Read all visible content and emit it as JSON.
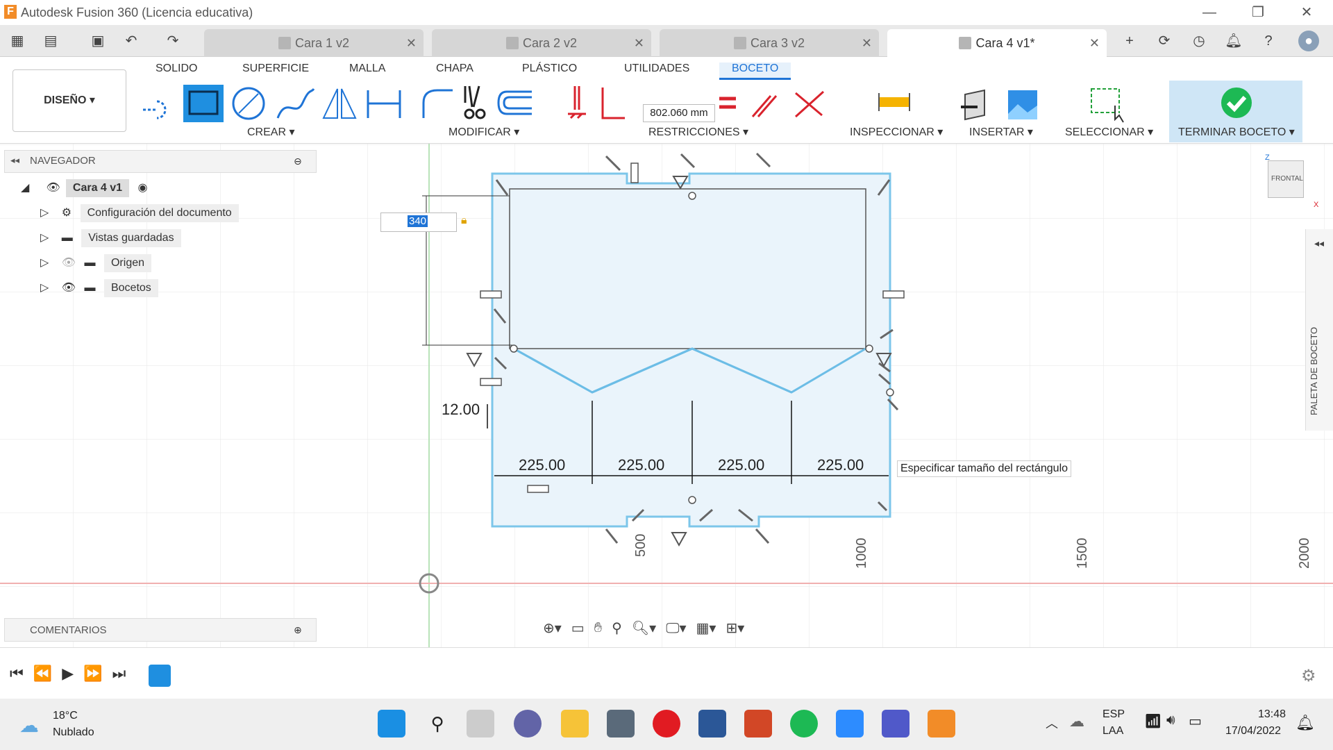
{
  "window": {
    "title": "Autodesk Fusion 360 (Licencia educativa)",
    "logo": "F"
  },
  "tabs": [
    {
      "label": "Cara 1 v2",
      "active": false
    },
    {
      "label": "Cara 2 v2",
      "active": false
    },
    {
      "label": "Cara 3 v2",
      "active": false
    },
    {
      "label": "Cara 4 v1*",
      "active": true
    }
  ],
  "ribbon": {
    "tabs": [
      "SOLIDO",
      "SUPERFICIE",
      "MALLA",
      "CHAPA",
      "PLÁSTICO",
      "UTILIDADES",
      "BOCETO"
    ],
    "active_tab": "BOCETO",
    "workspace": "DISEÑO ▾",
    "groups": {
      "crear": "CREAR ▾",
      "modificar": "MODIFICAR ▾",
      "restricciones": "RESTRICCIONES ▾",
      "inspeccionar": "INSPECCIONAR ▾",
      "insertar": "INSERTAR ▾",
      "seleccionar": "SELECCIONAR ▾",
      "terminar": "TERMINAR BOCETO ▾"
    },
    "length_readout": "802.060 mm"
  },
  "navigator": {
    "title": "NAVEGADOR",
    "root": "Cara 4 v1",
    "items": [
      "Configuración del documento",
      "Vistas guardadas",
      "Origen",
      "Bocetos"
    ]
  },
  "comments": {
    "title": "COMENTARIOS"
  },
  "canvas": {
    "dimension_input": "340",
    "dimension_left": "12.00",
    "widths": [
      "225.00",
      "225.00",
      "225.00",
      "225.00"
    ],
    "tooltip": "Especificar tamaño del rectángulo",
    "axis_ticks": [
      "500",
      "1000",
      "1500",
      "2000"
    ],
    "viewcube": "FRONTAL",
    "axis_z": "Z",
    "axis_x": "X",
    "sketch_palette": "PALETA DE BOCETO"
  },
  "colors": {
    "accent": "#1f74d6",
    "sketch_fill": "#eaf4fb",
    "sketch_line": "#7cc6ea",
    "finish_green": "#1db954"
  },
  "taskbar": {
    "weather_temp": "18°C",
    "weather_desc": "Nublado",
    "lang_top": "ESP",
    "lang_bottom": "LAA",
    "time": "13:48",
    "date": "17/04/2022"
  }
}
